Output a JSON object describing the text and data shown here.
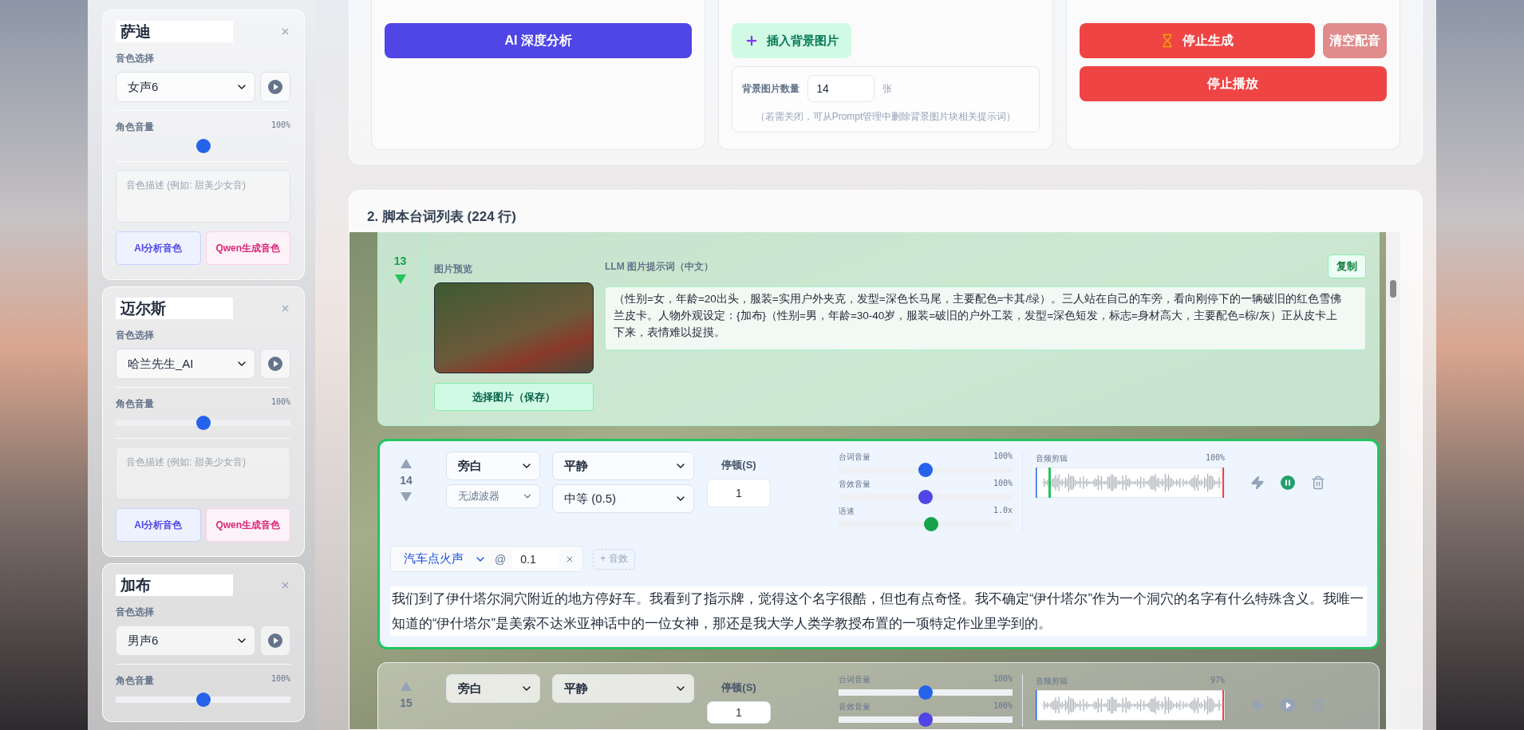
{
  "voices": [
    {
      "name": "萨迪",
      "voice_label": "音色选择",
      "voice": "女声6",
      "volume_label": "角色音量",
      "volume_reading": "100%",
      "level": 0.5,
      "description_placeholder": "音色描述 (例如: 甜美少女音)",
      "buttons": [
        "AI分析音色",
        "Qwen生成音色"
      ]
    },
    {
      "name": "迈尔斯",
      "voice_label": "音色选择",
      "voice": "哈兰先生_AI",
      "volume_label": "角色音量",
      "volume_reading": "100%",
      "level": 0.5,
      "description_placeholder": "音色描述 (例如: 甜美少女音)",
      "buttons": [
        "AI分析音色",
        "Qwen生成音色"
      ]
    },
    {
      "name": "加布",
      "voice_label": "音色选择",
      "voice": "男声6",
      "volume_label": "角色音量",
      "volume_reading": "100%",
      "level": 0.5
    }
  ],
  "analysis": {
    "button": "AI 深度分析"
  },
  "background_images": {
    "button": "插入背景图片",
    "count_label": "背景图片数量",
    "count": "14",
    "unit": "张",
    "hint": "（若需关闭，可从Prompt管理中删除背景图片块相关提示词）"
  },
  "generation": {
    "stop_generate": "停止生成",
    "clear": "清空配音",
    "stop_play": "停止播放"
  },
  "script": {
    "title": "2. 脚本台词列表 (224 行)",
    "rows": [
      {
        "kind": "image",
        "number": "13",
        "selected": false,
        "preview_label": "图片预览",
        "choose_button": "选择图片（保存）",
        "prompt_label": "LLM 图片提示词（中文）",
        "copy_button": "复制",
        "prompt": "（性别=女，年龄=20出头，服装=实用户外夹克，发型=深色长马尾，主要配色=卡其/绿）。三人站在自己的车旁，看向刚停下的一辆破旧的红色雪佛兰皮卡。人物外观设定：{加布}（性别=男，年龄=30-40岁，服装=破旧的户外工装，发型=深色短发，标志=身材高大，主要配色=棕/灰）正从皮卡上下来，表情难以捉摸。"
      },
      {
        "kind": "line",
        "number": "14",
        "selected": true,
        "speaker": "旁白",
        "filter": "无滤波器",
        "emotion": "平静",
        "speed": "中等 (0.5)",
        "pause_label": "停顿(S)",
        "pause": "1",
        "sliders": [
          {
            "label": "台词音量",
            "reading": "100%",
            "level": 0.5,
            "color": "#2563eb"
          },
          {
            "label": "音效音量",
            "reading": "100%",
            "level": 0.5,
            "color": "#4f46e5"
          },
          {
            "label": "语速",
            "reading": "1.0x",
            "level": 0.53,
            "color": "#16a34a"
          }
        ],
        "clip_label": "音频剪辑",
        "clip_reading": "100%",
        "playing": true,
        "effects": [
          {
            "name": "汽车点火声",
            "at": "@",
            "time": "0.1"
          }
        ],
        "add_effect": "+ 音效",
        "text": "我们到了伊什塔尔洞穴附近的地方停好车。我看到了指示牌，觉得这个名字很酷，但也有点奇怪。我不确定“伊什塔尔”作为一个洞穴的名字有什么特殊含义。我唯一知道的“伊什塔尔”是美索不达米亚神话中的一位女神，那还是我大学人类学教授布置的一项特定作业里学到的。"
      },
      {
        "kind": "line",
        "number": "15",
        "selected": false,
        "speaker": "旁白",
        "emotion": "平静",
        "pause_label": "停顿(S)",
        "pause": "1",
        "sliders": [
          {
            "label": "台词音量",
            "reading": "100%",
            "level": 0.5,
            "color": "#2563eb"
          },
          {
            "label": "音效音量",
            "reading": "100%",
            "level": 0.5,
            "color": "#4f46e5"
          }
        ],
        "clip_label": "音频剪辑",
        "clip_reading": "97%",
        "playing": false
      }
    ]
  }
}
